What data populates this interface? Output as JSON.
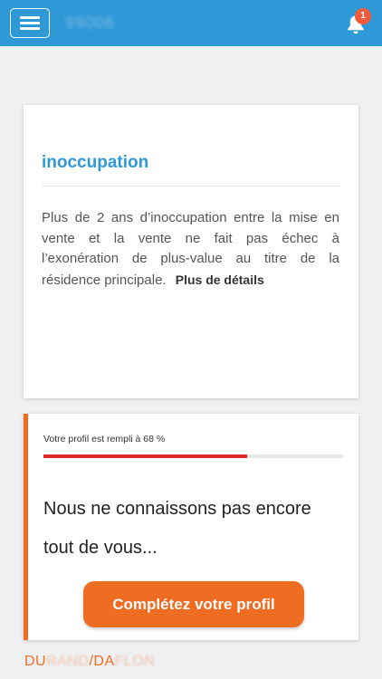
{
  "header": {
    "app_title": "99006",
    "notification_count": "1",
    "background": "#2f98d6"
  },
  "info_card": {
    "title": "inoccupation",
    "body": "Plus de 2 ans d’inoccupation entre la mise en vente et la vente ne fait pas échec à l’exonération de plus-value au titre de la résidence principale.",
    "details_link": "Plus de détails"
  },
  "profile_card": {
    "status": "Votre profil est rempli à 68 %",
    "progress": 0.68,
    "message": "Nous ne connaissons pas encore tout de vous...",
    "cta_label": "Complétez votre profil",
    "accent": "#ef6c23"
  },
  "footer": {
    "logo_parts": [
      "DU",
      "RAND",
      "/DA",
      "FLON"
    ]
  },
  "icons": [
    "menu-icon",
    "bell-icon"
  ]
}
